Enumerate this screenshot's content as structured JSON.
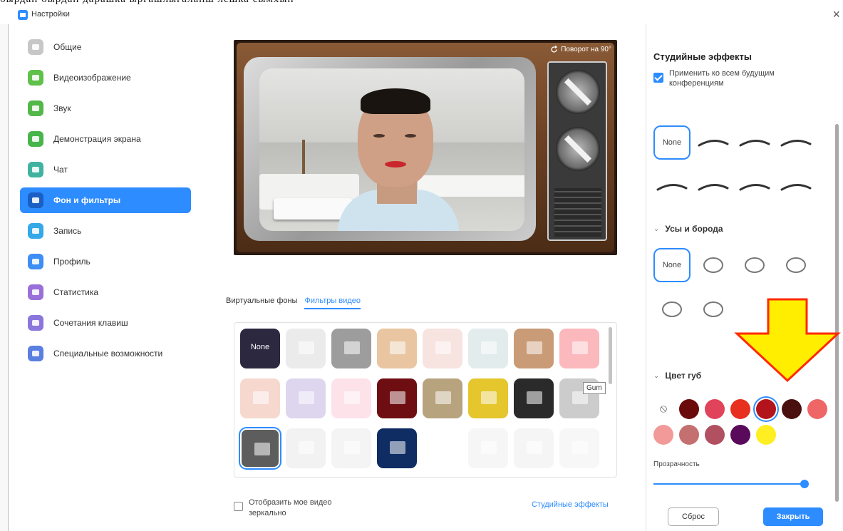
{
  "window": {
    "title": "Настройки",
    "close_glyph": "×"
  },
  "sidebar": {
    "items": [
      {
        "label": "Общие",
        "icon": "gear-icon",
        "color": "#c7c7c7"
      },
      {
        "label": "Видеоизображение",
        "icon": "video-icon",
        "color": "#5fc04a"
      },
      {
        "label": "Звук",
        "icon": "headphones-icon",
        "color": "#53b74a"
      },
      {
        "label": "Демонстрация экрана",
        "icon": "share-screen-icon",
        "color": "#48b54a"
      },
      {
        "label": "Чат",
        "icon": "chat-icon",
        "color": "#40b2a0"
      },
      {
        "label": "Фон и фильтры",
        "icon": "background-icon",
        "color": "#ffffff",
        "active": true
      },
      {
        "label": "Запись",
        "icon": "record-icon",
        "color": "#33a9e8"
      },
      {
        "label": "Профиль",
        "icon": "profile-icon",
        "color": "#3d8ef5"
      },
      {
        "label": "Статистика",
        "icon": "stats-icon",
        "color": "#9b6fd9"
      },
      {
        "label": "Сочетания клавиш",
        "icon": "keyboard-icon",
        "color": "#8a76dc"
      },
      {
        "label": "Специальные возможности",
        "icon": "accessibility-icon",
        "color": "#5b7fe0"
      }
    ]
  },
  "preview": {
    "rotate_label": "Поворот на 90°"
  },
  "tabs": {
    "virtual_bg": "Виртуальные фоны",
    "video_filters": "Фильтры видео"
  },
  "filters": {
    "none_label": "None",
    "tooltip": "Gum",
    "tile_colors": [
      "#2b2840",
      "#ebebeb",
      "#9d9d9d",
      "#e9c5a1",
      "#f7e3df",
      "#e2ecec",
      "#c99b76",
      "#fbb9bd",
      "#f6d8cf",
      "#ddd6ee",
      "#fde2ea",
      "#6e0e12",
      "#b7a37e",
      "#e5c62d",
      "#2a2a2a",
      "#cccccc",
      "#5d5d5d",
      "#f2f2f2",
      "#f4f4f4",
      "#0f2c63",
      "#ffffff",
      "#f6f6f6",
      "#f5f5f5",
      "#f7f7f7"
    ]
  },
  "mirror": {
    "label": "Отобразить мое видео зеркально"
  },
  "studio_link": "Студийные эффекты",
  "right_panel": {
    "title": "Студийные эффекты",
    "apply_label": "Применить ко всем будущим конференциям",
    "none_label": "None",
    "section_beard": "Усы и борода",
    "section_lips": "Цвет губ",
    "chevron": "⌄",
    "no_color_glyph": "⦸",
    "lip_colors": [
      "#6b0a0a",
      "#e0435a",
      "#e8301e",
      "#b3141c",
      "#4a1010",
      "#ee6666",
      "#f29a9a",
      "#c47070",
      "#b05060",
      "#5a0a5a",
      "#ffee22"
    ],
    "selected_lip_color": "#b3141c",
    "transparency_label": "Прозрачность",
    "transparency_value": 1.0,
    "reset_label": "Сброс",
    "close_label": "Закрыть"
  },
  "annotation": {
    "arrow_color": "#ffee00",
    "arrow_outline": "#ff2a00"
  }
}
